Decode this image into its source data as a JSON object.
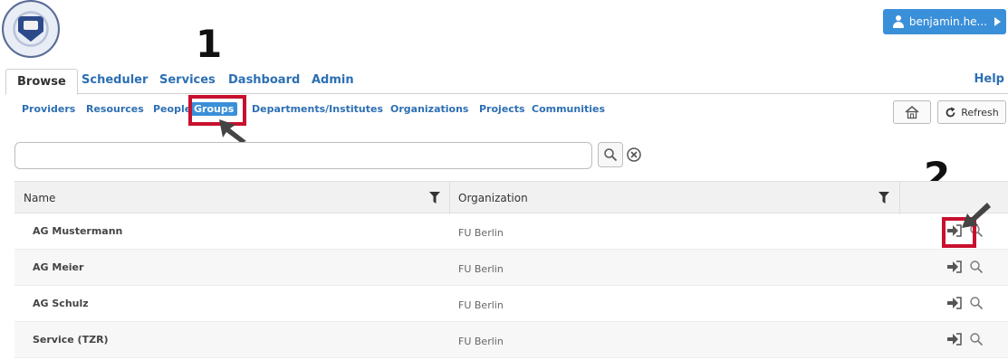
{
  "user": {
    "name": "benjamin.he..."
  },
  "annotations": {
    "step1": "1",
    "step2": "2"
  },
  "main_tabs": [
    {
      "label": "Browse",
      "active": true
    },
    {
      "label": "Scheduler"
    },
    {
      "label": "Services"
    },
    {
      "label": "Dashboard"
    },
    {
      "label": "Admin"
    }
  ],
  "help_label": "Help",
  "subnav": [
    {
      "label": "Providers"
    },
    {
      "label": "Resources"
    },
    {
      "label": "People"
    },
    {
      "label": "Groups",
      "active": true
    },
    {
      "label": "Departments/Institutes"
    },
    {
      "label": "Organizations"
    },
    {
      "label": "Projects"
    },
    {
      "label": "Communities"
    }
  ],
  "toolbar": {
    "refresh_label": "Refresh"
  },
  "search": {
    "value": ""
  },
  "table": {
    "columns": [
      "Name",
      "Organization"
    ],
    "rows": [
      {
        "name": "AG Mustermann",
        "organization": "FU Berlin"
      },
      {
        "name": "AG Meier",
        "organization": "FU Berlin"
      },
      {
        "name": "AG Schulz",
        "organization": "FU Berlin"
      },
      {
        "name": "Service (TZR)",
        "organization": "FU Berlin"
      }
    ]
  },
  "colors": {
    "accent": "#3a8fd9",
    "link": "#2c6fb3",
    "highlight": "#c8102e"
  }
}
